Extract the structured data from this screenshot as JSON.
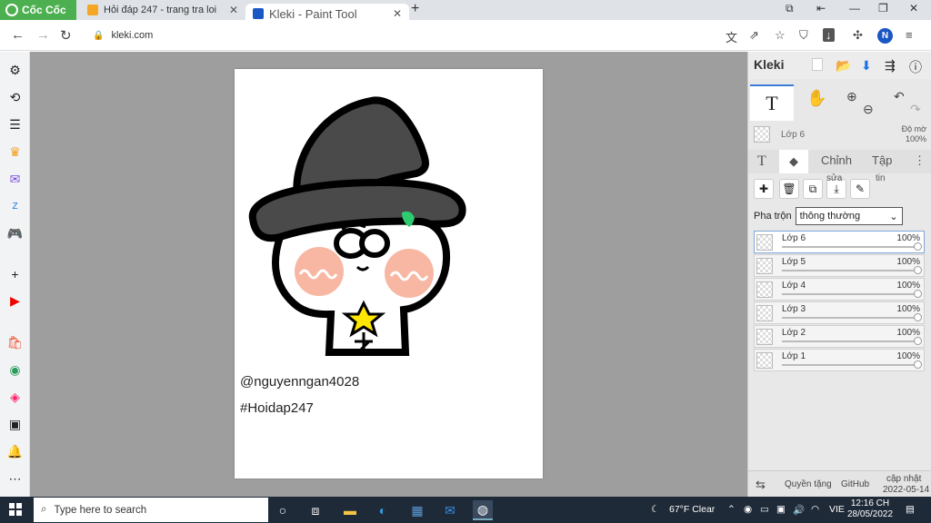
{
  "browser": {
    "brand": "Cốc Cốc",
    "tabs": [
      {
        "title": "Hỏi đáp 247 - trang tra loi",
        "favicon_color": "#f5a623"
      },
      {
        "title": "Kleki - Paint Tool",
        "favicon_color": "#1a56c4"
      }
    ],
    "url": "kleki.com",
    "profile_initial": "N"
  },
  "canvas": {
    "handle": "@nguyenngan4028",
    "hashtag": "#Hoidap247"
  },
  "kleki": {
    "logo": "Kleki",
    "active_tool": "T",
    "layer_summary": {
      "name": "Lớp 6",
      "opacity_label": "Độ mờ",
      "opacity_value": "100%"
    },
    "panel_tabs": {
      "text": "T",
      "edit": "Chỉnh",
      "file": "Tập"
    },
    "merge_label": "sửa",
    "info_label": "tin",
    "blend_label": "Pha trộn",
    "blend_mode": "thông thường",
    "layers": [
      {
        "name": "Lớp 6",
        "opacity": "100%",
        "fill": 1.0
      },
      {
        "name": "Lớp 5",
        "opacity": "100%",
        "fill": 1.0
      },
      {
        "name": "Lớp 4",
        "opacity": "100%",
        "fill": 1.0
      },
      {
        "name": "Lớp 3",
        "opacity": "100%",
        "fill": 1.0
      },
      {
        "name": "Lớp 2",
        "opacity": "100%",
        "fill": 1.0
      },
      {
        "name": "Lớp 1",
        "opacity": "100%",
        "fill": 1.0
      }
    ],
    "footer": {
      "privacy": "Quyền tặng",
      "github": "GitHub",
      "updated_label": "cập nhật",
      "updated_date": "2022-05-14"
    }
  },
  "taskbar": {
    "search_placeholder": "Type here to search",
    "weather": "67°F  Clear",
    "lang": "VIE",
    "time": "12:16 CH",
    "date": "28/05/2022"
  },
  "colors": {
    "brand_green": "#4caf50",
    "hat": "#4a4a4a",
    "blush": "#f7b7a3",
    "star": "#ffe600",
    "leaf": "#2ecc71",
    "taskbar": "#1f2a38"
  }
}
